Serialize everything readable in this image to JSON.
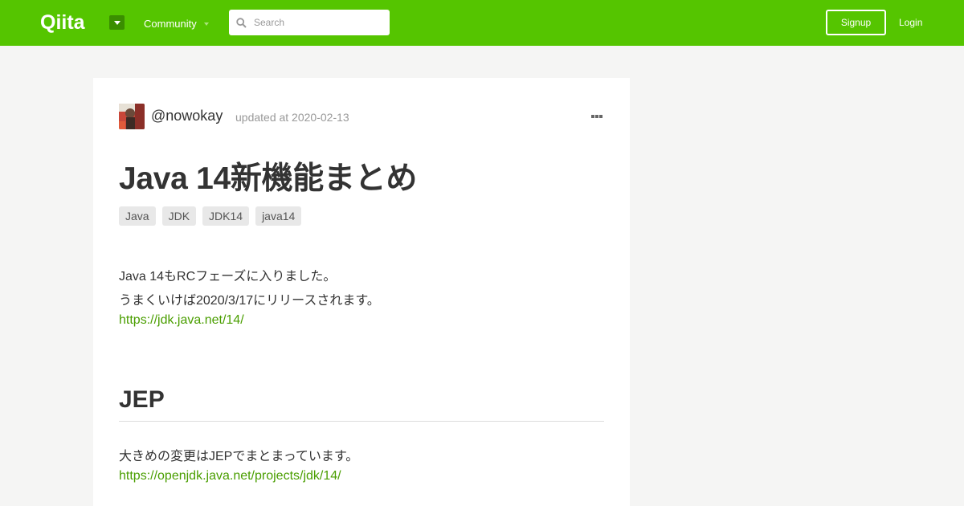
{
  "header": {
    "logo_text": "Qiita",
    "community_label": "Community",
    "search_placeholder": "Search",
    "signup_label": "Signup",
    "login_label": "Login",
    "accent_color": "#55c500"
  },
  "article": {
    "username": "@nowokay",
    "updated": "updated at 2020-02-13",
    "title": "Java 14新機能まとめ",
    "tags": [
      "Java",
      "JDK",
      "JDK14",
      "java14"
    ],
    "intro_line1": "Java 14もRCフェーズに入りました。",
    "intro_line2": "うまくいけば2020/3/17にリリースされます。",
    "intro_link": "https://jdk.java.net/14/",
    "section_heading": "JEP",
    "section_line1": "大きめの変更はJEPでまとまっています。",
    "section_link": "https://openjdk.java.net/projects/jdk/14/",
    "link_color": "#4a9e00"
  }
}
